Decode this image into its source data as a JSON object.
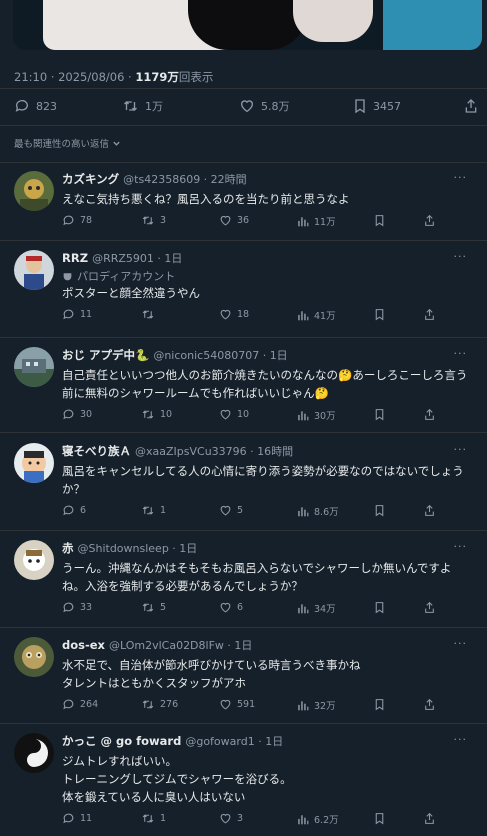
{
  "tweet": {
    "time": "21:10 · 2025/08/06 · ",
    "views_count": "1179万",
    "views_label": "回表示",
    "stats": {
      "replies": "823",
      "retweets": "1万",
      "likes": "5.8万",
      "bookmarks": "3457"
    }
  },
  "sort_label": "最も関連性の高い返信",
  "replies": [
    {
      "name": "カズキング",
      "handle": "@ts42358609 · 22時間",
      "badge": "",
      "text": "えなこ気持ち悪くね？風呂入るのを当たり前と思うなよ",
      "replies": "78",
      "retweets": "3",
      "likes": "36",
      "views": "11万"
    },
    {
      "name": "RRZ",
      "handle": "@RRZ5901 · 1日",
      "badge": "パロディアカウント",
      "text": "ポスターと顔全然違うやん",
      "replies": "11",
      "retweets": "",
      "likes": "18",
      "views": "41万"
    },
    {
      "name": "おじ アプデ中🐍",
      "handle": "@niconic54080707 · 1日",
      "badge": "",
      "text": "自己責任といいつつ他人のお節介焼きたいのなんなの🤔あーしろこーしろ言う前に無料のシャワールームでも作ればいいじゃん🤔",
      "replies": "30",
      "retweets": "10",
      "likes": "10",
      "views": "30万"
    },
    {
      "name": "寝そべり族Ａ",
      "handle": "@xaaZIpsVCu33796 · 16時間",
      "badge": "",
      "text": "風呂をキャンセルしてる人の心情に寄り添う姿勢が必要なのではないでしょうか？",
      "replies": "6",
      "retweets": "1",
      "likes": "5",
      "views": "8.6万"
    },
    {
      "name": "赤",
      "handle": "@Shitdownsleep · 1日",
      "badge": "",
      "text": "うーん。沖縄なんかはそもそもお風呂入らないでシャワーしか無いんですよね。入浴を強制する必要があるんでしょうか？",
      "replies": "33",
      "retweets": "5",
      "likes": "6",
      "views": "34万"
    },
    {
      "name": "dos-ex",
      "handle": "@LOm2vlCa02D8lFw · 1日",
      "badge": "",
      "text": "水不足で、自治体が節水呼びかけている時言うべき事かね\nタレントはともかくスタッフがアホ",
      "replies": "264",
      "retweets": "276",
      "likes": "591",
      "views": "32万"
    },
    {
      "name": "かっこ @ go foward",
      "handle": "@gofoward1 · 1日",
      "badge": "",
      "text": "ジムトレすればいい。\nトレーニングしてジムでシャワーを浴びる。\n体を鍛えている人に臭い人はいない",
      "replies": "11",
      "retweets": "1",
      "likes": "3",
      "views": "6.2万"
    }
  ]
}
